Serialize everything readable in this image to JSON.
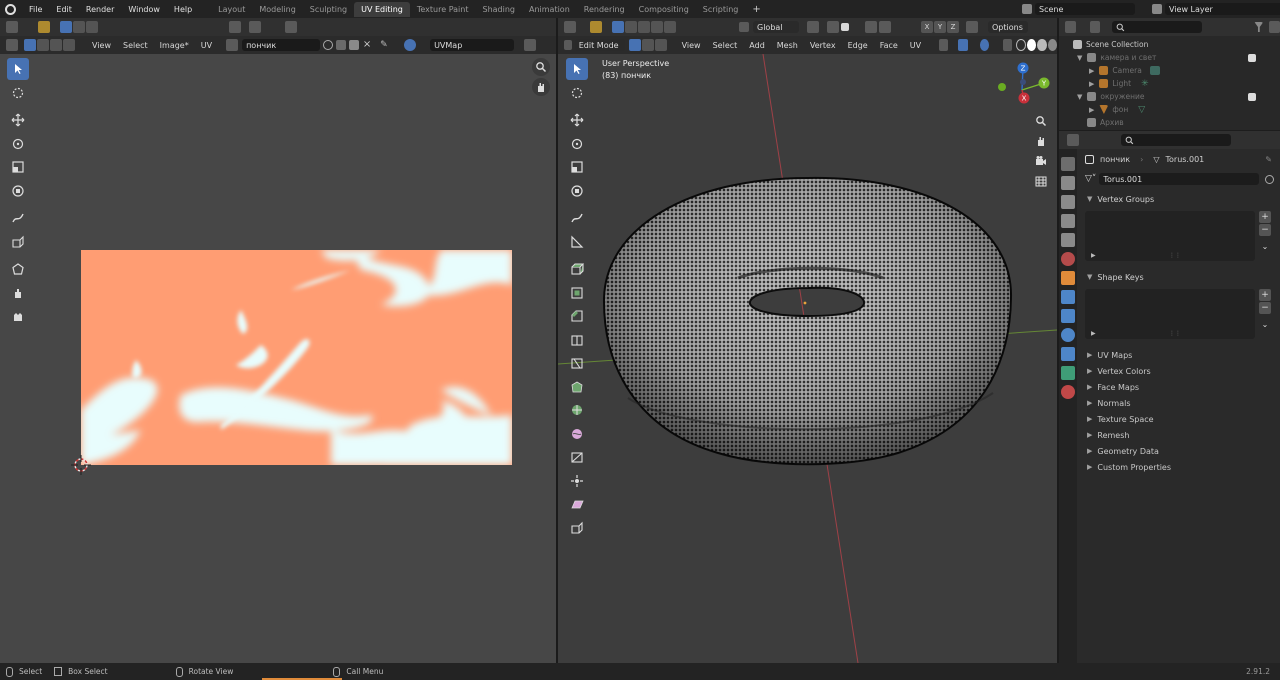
{
  "topbar": {
    "menus": [
      "File",
      "Edit",
      "Render",
      "Window",
      "Help"
    ],
    "workspace_tabs": [
      "Layout",
      "Modeling",
      "Sculpting",
      "UV Editing",
      "Texture Paint",
      "Shading",
      "Animation",
      "Rendering",
      "Compositing",
      "Scripting"
    ],
    "active_tab": "UV Editing",
    "add_tab": "+",
    "scene": "Scene",
    "view_layer": "View Layer"
  },
  "uv_editor": {
    "menus": [
      "View",
      "Select",
      "Image*",
      "UV"
    ],
    "image_name": "пончик",
    "uv_map": "UVMap",
    "texture_colors": {
      "base": "#ff9d73",
      "light": "#e8fdfd"
    }
  },
  "viewport": {
    "mode": "Edit Mode",
    "menus": [
      "View",
      "Select",
      "Add",
      "Mesh",
      "Vertex",
      "Edge",
      "Face",
      "UV"
    ],
    "orientation": "Global",
    "options": "Options",
    "perspective_label": "User Perspective",
    "object_label": "(83) пончик",
    "gizmo": {
      "z": "Z",
      "y": "Y",
      "x": "X"
    },
    "axis_colors": {
      "x": "#c8303a",
      "y": "#7ab92d",
      "z": "#2e6fce"
    }
  },
  "outliner": {
    "search_placeholder": "",
    "items": [
      {
        "label": "Scene Collection",
        "indent": 0
      },
      {
        "label": "камера и свет",
        "indent": 1
      },
      {
        "label": "Camera",
        "indent": 2
      },
      {
        "label": "Light",
        "indent": 2
      },
      {
        "label": "окружение",
        "indent": 1
      },
      {
        "label": "фон",
        "indent": 2
      },
      {
        "label": "Архив",
        "indent": 1
      }
    ]
  },
  "properties": {
    "object_name": "пончик",
    "mesh_name": "Torus.001",
    "data_field": "Torus.001",
    "panels_open": [
      "Vertex Groups",
      "Shape Keys"
    ],
    "panels_collapsed": [
      "UV Maps",
      "Vertex Colors",
      "Face Maps",
      "Normals",
      "Texture Space",
      "Remesh",
      "Geometry Data",
      "Custom Properties"
    ]
  },
  "statusbar": {
    "select": "Select",
    "box_select": "Box Select",
    "rotate_view": "Rotate View",
    "call_menu": "Call Menu",
    "version": "2.91.2"
  }
}
